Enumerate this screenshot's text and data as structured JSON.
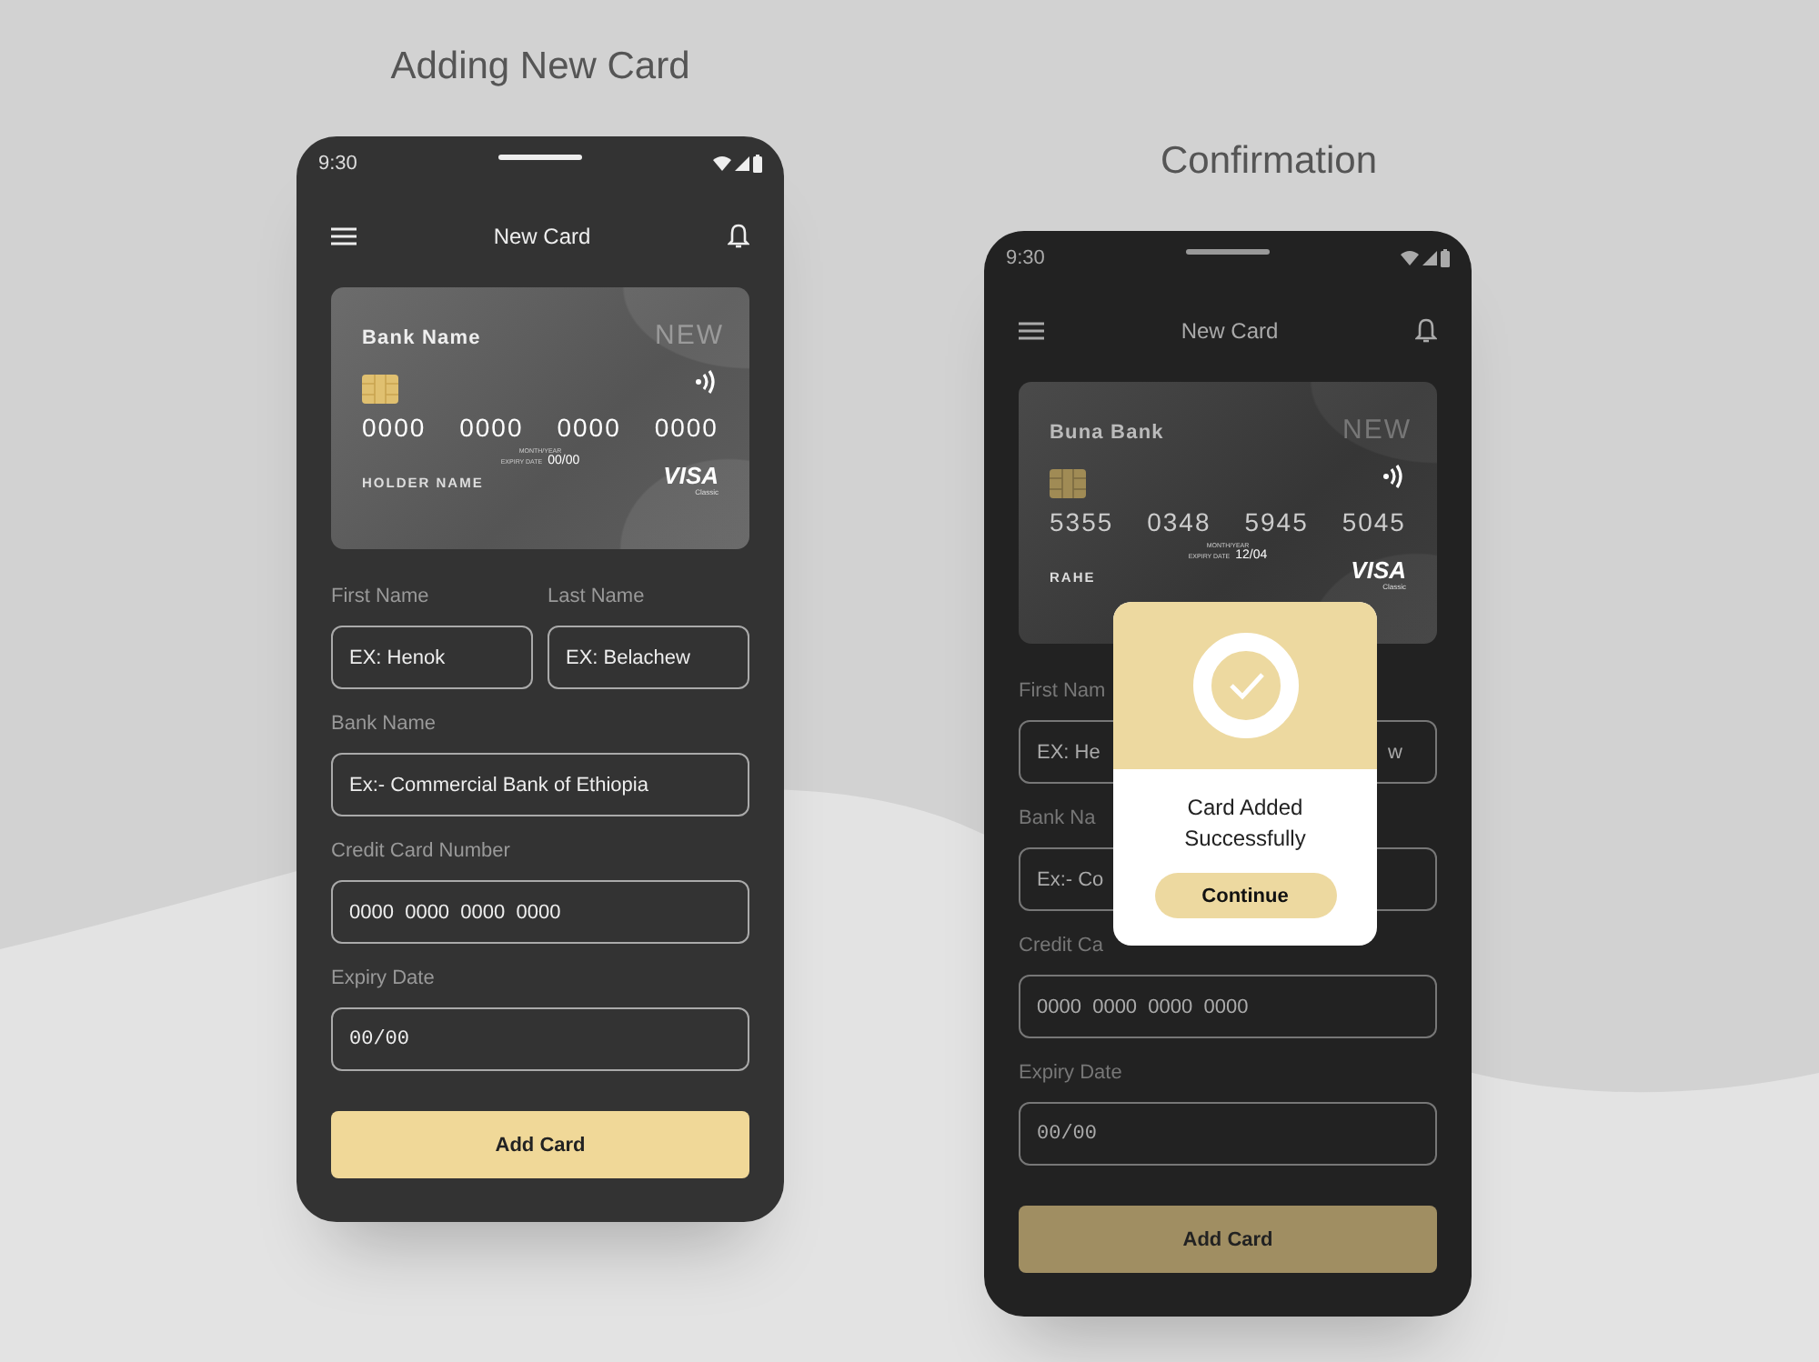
{
  "screens": [
    {
      "title": "Adding New Card",
      "status_time": "9:30",
      "header_title": "New Card",
      "card": {
        "bank_name": "Bank Name",
        "new_label": "NEW",
        "number_groups": [
          "0000",
          "0000",
          "0000",
          "0000"
        ],
        "month_year": "MONTH/YEAR",
        "expiry_label": "EXPIRY DATE",
        "expiry": "00/00",
        "holder": "HOLDER NAME",
        "brand": "VISA",
        "tier": "Classic"
      },
      "fields": [
        {
          "kind": "half",
          "label": "First Name",
          "placeholder": "EX: Henok"
        },
        {
          "kind": "half",
          "label": "Last Name",
          "placeholder": "EX: Belachew"
        },
        {
          "kind": "full",
          "label": "Bank Name",
          "placeholder": "Ex:- Commercial Bank of Ethiopia"
        },
        {
          "kind": "full",
          "label": "Credit Card Number",
          "placeholder": "0000  0000  0000  0000"
        },
        {
          "kind": "mono",
          "label": "Expiry Date",
          "placeholder": "00/00"
        }
      ],
      "submit_button": "Add Card"
    },
    {
      "title": "Confirmation",
      "status_time": "9:30",
      "header_title": "New Card",
      "card": {
        "bank_name": "Buna Bank",
        "new_label": "NEW",
        "number_groups": [
          "5355",
          "0348",
          "5945",
          "5045"
        ],
        "month_year": "MONTH/YEAR",
        "expiry_label": "EXPIRY DATE",
        "expiry": "12/04",
        "holder": "RAHE",
        "brand": "VISA",
        "tier": "Classic"
      },
      "fields": [
        {
          "kind": "half",
          "label": "First Nam",
          "placeholder": "EX: He"
        },
        {
          "kind": "covered_half",
          "placeholder": "w"
        },
        {
          "kind": "full",
          "label": "Bank Na",
          "placeholder": "Ex:- Co"
        },
        {
          "kind": "full",
          "label": "Credit Ca",
          "placeholder": "0000  0000  0000  0000"
        },
        {
          "kind": "mono",
          "label": "Expiry Date",
          "placeholder": "00/00"
        }
      ],
      "submit_button": "Add Card",
      "dialog": {
        "message": "Card Added Successfully",
        "button": "Continue"
      }
    }
  ]
}
